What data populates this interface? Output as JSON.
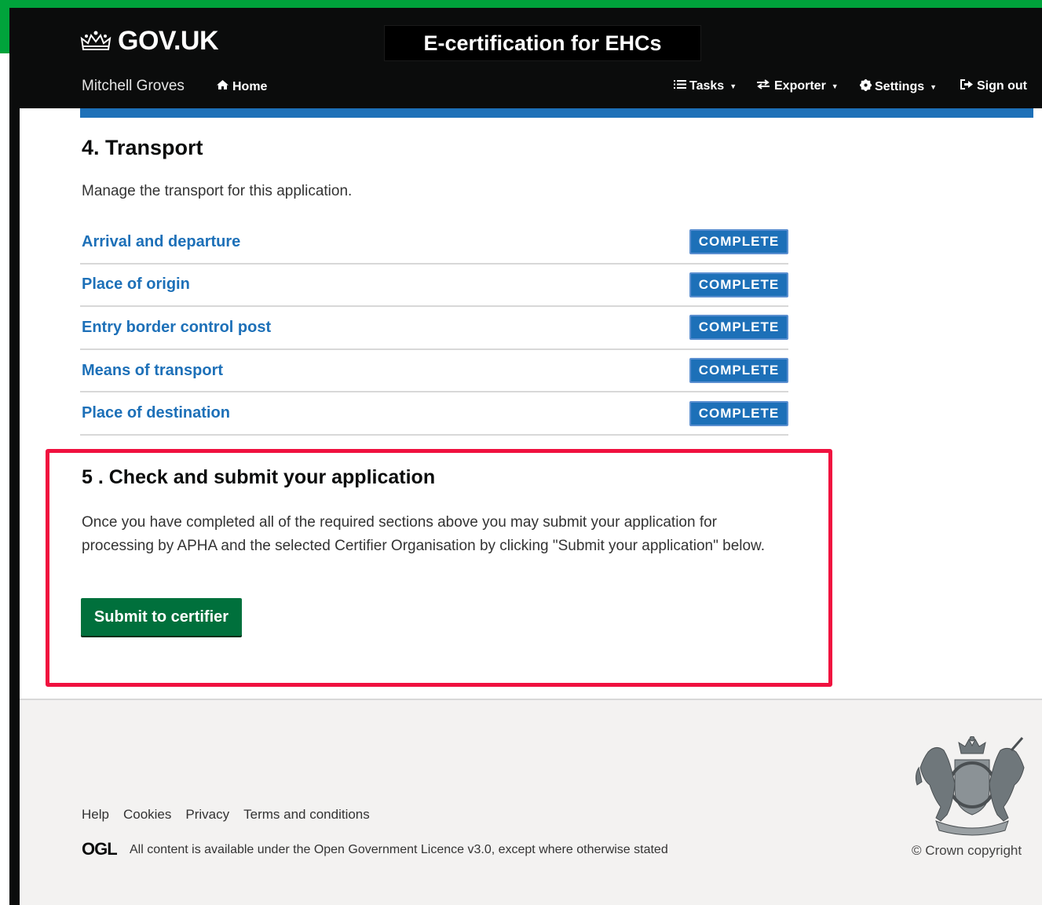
{
  "header": {
    "logo_text": "GOV.UK",
    "service_name": "E-certification for EHCs",
    "user_name": "Mitchell Groves",
    "nav": {
      "home": "Home",
      "tasks": "Tasks",
      "exporter": "Exporter",
      "settings": "Settings",
      "sign_out": "Sign out"
    }
  },
  "transport": {
    "heading": "4. Transport",
    "description": "Manage the transport for this application.",
    "items": [
      {
        "label": "Arrival and departure",
        "status": "COMPLETE"
      },
      {
        "label": "Place of origin",
        "status": "COMPLETE"
      },
      {
        "label": "Entry border control post",
        "status": "COMPLETE"
      },
      {
        "label": "Means of transport",
        "status": "COMPLETE"
      },
      {
        "label": "Place of destination",
        "status": "COMPLETE"
      }
    ]
  },
  "submit_section": {
    "heading": "5 . Check and submit your application",
    "description": "Once you have completed all of the required sections above you may submit your application for processing by APHA and the selected Certifier Organisation by clicking \"Submit your application\" below.",
    "button_label": "Submit to certifier"
  },
  "footer": {
    "links": [
      "Help",
      "Cookies",
      "Privacy",
      "Terms and conditions"
    ],
    "ogl_logo": "OGL",
    "licence_text": "All content is available under the Open Government Licence v3.0, except where otherwise stated",
    "copyright": "© Crown copyright"
  },
  "colors": {
    "link_blue": "#1d70b8",
    "button_green": "#00703c",
    "highlight_red": "#f0113f",
    "frame_green": "#00a33b"
  }
}
